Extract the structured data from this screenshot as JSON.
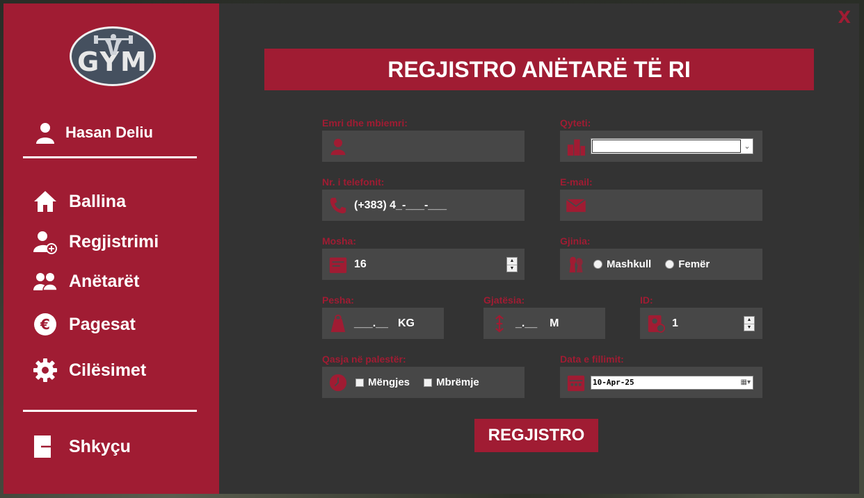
{
  "app": {
    "logo_text": "GYM",
    "close_label": "X",
    "accent_color": "#a01c33"
  },
  "sidebar": {
    "user_name": "Hasan Deliu",
    "nav": [
      {
        "label": "Ballina",
        "icon": "home-icon"
      },
      {
        "label": "Regjistrimi",
        "icon": "add-user-icon"
      },
      {
        "label": "Anëtarët",
        "icon": "users-icon"
      },
      {
        "label": "Pagesat",
        "icon": "euro-icon"
      },
      {
        "label": "Cilësimet",
        "icon": "gear-icon"
      }
    ],
    "logout_label": "Shkyçu"
  },
  "form": {
    "title": "REGJISTRO ANËTARË TË RI",
    "name": {
      "label": "Emri dhe mbiemri:",
      "value": ""
    },
    "city": {
      "label": "Qyteti:",
      "value": ""
    },
    "phone": {
      "label": "Nr. i telefonit:",
      "value": "(+383) 4_-___-___"
    },
    "email": {
      "label": "E-mail:",
      "value": ""
    },
    "age": {
      "label": "Mosha:",
      "value": "16"
    },
    "gender": {
      "label": "Gjinia:",
      "options": [
        "Mashkull",
        "Femër"
      ]
    },
    "weight": {
      "label": "Pesha:",
      "value": "___.__",
      "unit": "KG"
    },
    "height": {
      "label": "Gjatësia:",
      "value": "_.__",
      "unit": "M"
    },
    "id": {
      "label": "ID:",
      "value": "1"
    },
    "access": {
      "label": "Qasja në palestër:",
      "options": [
        "Mëngjes",
        "Mbrëmje"
      ]
    },
    "start_date": {
      "label": "Data e fillimit:",
      "value": "10-Apr-25"
    },
    "submit_label": "REGJISTRO"
  }
}
